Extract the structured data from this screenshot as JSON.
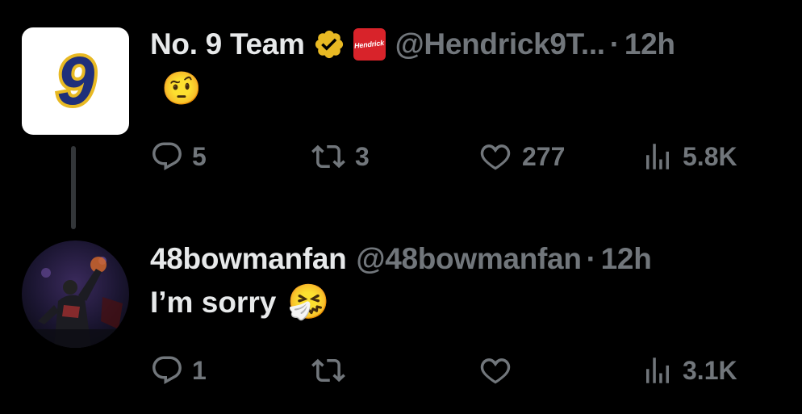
{
  "tweets": [
    {
      "author_name": "No. 9 Team",
      "handle": "@Hendrick9T...",
      "separator": "·",
      "time": "12h",
      "affiliate_badge": "Hendrick",
      "avatar_text": "9",
      "text": "",
      "emoji": "🤨",
      "reply_count": "5",
      "retweet_count": "3",
      "like_count": "277",
      "view_count": "5.8K"
    },
    {
      "author_name": "48bowmanfan",
      "handle": "@48bowmanfan",
      "separator": "·",
      "time": "12h",
      "text": "I’m sorry",
      "emoji": "🤧",
      "reply_count": "1",
      "retweet_count": "",
      "like_count": "",
      "view_count": "3.1K"
    }
  ],
  "colors": {
    "background": "#000000",
    "primary_text": "#e7e9ea",
    "secondary_text": "#71767b",
    "verified_gold": "#e8b923",
    "affiliate_red": "#d8232a",
    "avatar_blue": "#1f2f7a"
  },
  "icons": [
    "verified-badge-icon",
    "reply-icon",
    "retweet-icon",
    "like-icon",
    "views-icon"
  ]
}
